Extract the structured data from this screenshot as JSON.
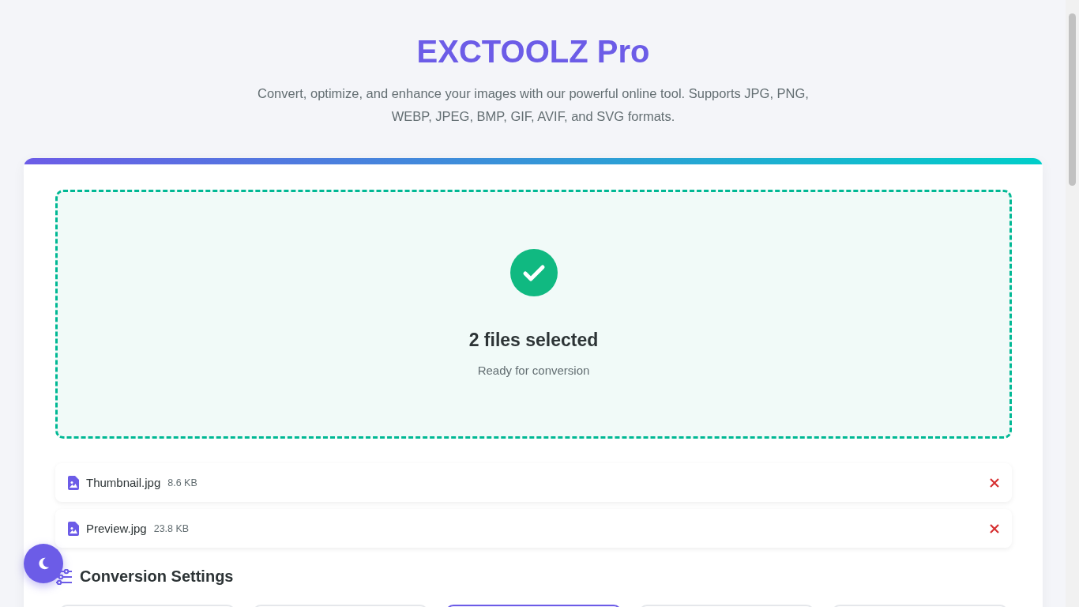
{
  "header": {
    "title": "EXCTOOLZ Pro",
    "subtitle": "Convert, optimize, and enhance your images with our powerful online tool. Supports JPG, PNG, WEBP, JPEG, BMP, GIF, AVIF, and SVG formats."
  },
  "dropzone": {
    "has_files": true,
    "title": "2 files selected",
    "status": "Ready for conversion"
  },
  "files": [
    {
      "name": "Thumbnail.jpg",
      "size": "8.6 KB"
    },
    {
      "name": "Preview.jpg",
      "size": "23.8 KB"
    }
  ],
  "settings": {
    "title": "Conversion Settings",
    "format_options": [
      {
        "selected": false
      },
      {
        "selected": false
      },
      {
        "selected": true
      },
      {
        "selected": false
      },
      {
        "selected": false
      }
    ]
  }
}
